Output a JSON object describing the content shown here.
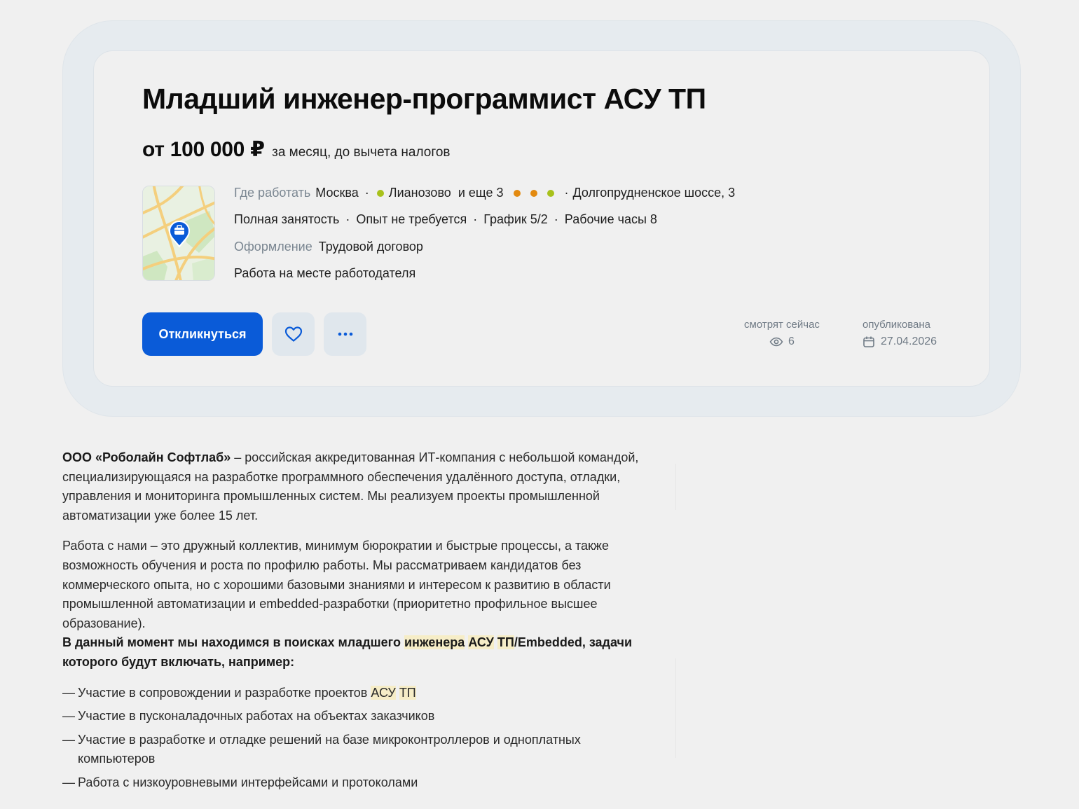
{
  "vacancy": {
    "title": "Младший инженер-программист АСУ ТП",
    "salary": {
      "amount": "от 100 000 ₽",
      "note": "за месяц, до вычета налогов"
    },
    "location": {
      "label": "Где работать",
      "city": "Москва",
      "metro": "Лианозово",
      "more": "и еще 3",
      "address": "Долгопрудненское шоссе, 3",
      "metro_color": "#a8c11b",
      "more_colors": [
        "#e38a10",
        "#e38a10",
        "#a8c11b"
      ]
    },
    "conditions": [
      "Полная занятость",
      "Опыт не требуется",
      "График 5/2",
      "Рабочие часы 8"
    ],
    "contract": {
      "label": "Оформление",
      "value": "Трудовой договор"
    },
    "work_place": "Работа на месте работодателя",
    "actions": {
      "apply_label": "Откликнуться",
      "favorite_icon": "heart-icon",
      "more_icon": "more-horizontal-icon"
    },
    "stats": {
      "viewing_label": "смотрят сейчас",
      "viewing_count": "6",
      "published_label": "опубликована",
      "published_date": "27.04.2026"
    },
    "accent_color": "#0a5bd8"
  },
  "description": {
    "intro_company": "ООО «Роболайн Софтлаб»",
    "intro_text": " – российская аккредитованная ИТ-компания с небольшой командой, специализирующаяся на разработке программного обеспечения удалённого доступа, отладки, управления и мониторинга промышленных систем. Мы реализуем проекты промышленной автоматизации уже более 15 лет.",
    "paragraph2": "Работа с нами – это дружный коллектив, минимум бюрократии и быстрые процессы, а также возможность обучения и роста по профилю работы. Мы рассматриваем кандидатов без коммерческого опыта, но с хорошими базовыми знаниями и интересом к развитию в области промышленной автоматизации и embedded-разработки (приоритетно профильное высшее образование).",
    "heading": {
      "part1": "В данный момент мы находимся в поисках младшего ",
      "hl1": "инженера",
      "hl2": "АСУ",
      "hl3": "ТП",
      "part2": "/Embedded, задачи которого будут включать, например:"
    },
    "bullets": {
      "item1_text": "Участие в сопровождении и разработке проектов ",
      "item1_hl1": "АСУ",
      "item1_hl2": "ТП",
      "item2": "Участие в пусконаладочных работах на объектах заказчиков",
      "item3": "Участие в разработке и отладке решений на базе микроконтроллеров и одноплатных компьютеров",
      "item4": "Работа с низкоуровневыми интерфейсами и протоколами"
    }
  }
}
